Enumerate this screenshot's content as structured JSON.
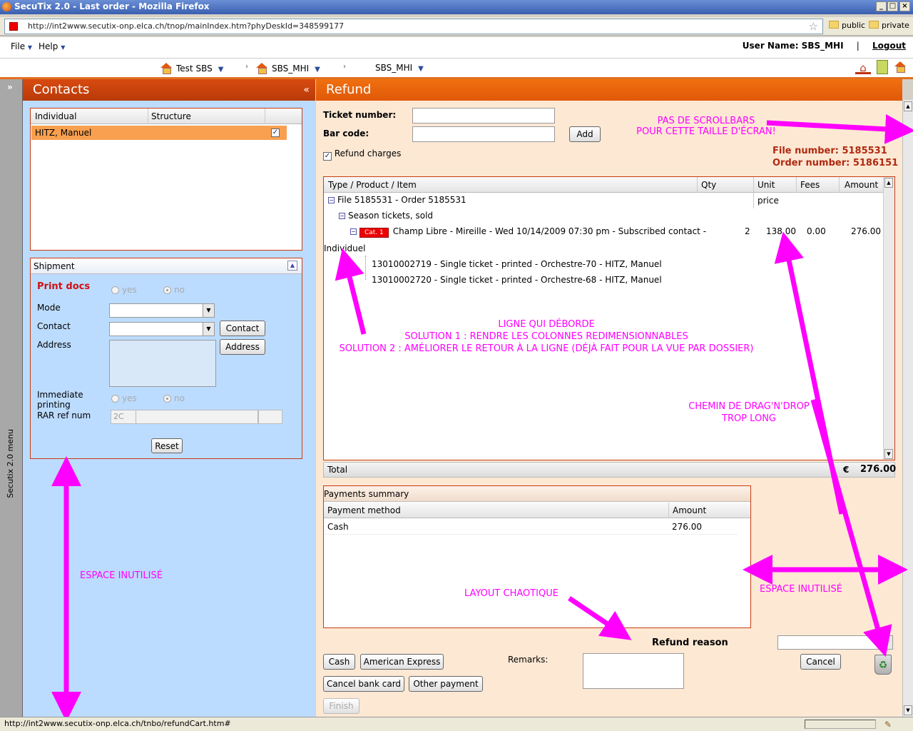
{
  "window": {
    "title": "SecuTix 2.0 - Last order - Mozilla Firefox"
  },
  "browser": {
    "url": "http://int2www.secutix-onp.elca.ch/tnop/mainIndex.htm?phyDeskId=348599177",
    "bookmarks": [
      "public",
      "private"
    ],
    "status_url": "http://int2www.secutix-onp.elca.ch/tnbo/refundCart.htm#"
  },
  "menubar": {
    "file": "File",
    "help": "Help",
    "user_name": "User Name: SBS_MHI",
    "separator": "|",
    "logout": "Logout"
  },
  "nav": {
    "items": [
      "Test SBS",
      "SBS_MHI",
      "SBS_MHI"
    ]
  },
  "sidebar": {
    "label": "Secutix 2.0 menu",
    "expand": "»"
  },
  "contacts": {
    "title": "Contacts",
    "collapse": "«",
    "columns": [
      "Individual",
      "Structure"
    ],
    "rows": [
      {
        "individual": "HITZ, Manuel",
        "checked": true
      }
    ]
  },
  "shipment": {
    "title": "Shipment",
    "print_docs": "Print docs",
    "yes": "yes",
    "no": "no",
    "mode": "Mode",
    "contact": "Contact",
    "contact_btn": "Contact",
    "address": "Address",
    "address_btn": "Address",
    "immediate_printing": "Immediate printing",
    "rar_ref_num": "RAR ref num",
    "rar_value": "2C",
    "reset": "Reset"
  },
  "refund": {
    "title": "Refund",
    "ticket_number_label": "Ticket number:",
    "bar_code_label": "Bar code:",
    "add_btn": "Add",
    "refund_charges": "Refund charges",
    "file_number": "File number: 5185531",
    "order_number": "Order number: 5186151",
    "grid": {
      "columns": [
        "Type / Product / Item",
        "Qty",
        "Unit price",
        "Fees",
        "Amount"
      ],
      "file_row": "File 5185531 - Order 5185531",
      "season_row": "Season tickets, sold",
      "cat": "Cat. 1",
      "item_row": "Champ Libre - Mireille - Wed 10/14/2009 07:30 pm - Subscribed contact -",
      "item_wrap": "Individuel",
      "item_qty": "2",
      "item_unit": "138.00",
      "item_fees": "0.00",
      "item_amount": "276.00",
      "tickets": [
        "13010002719 - Single ticket - printed - Orchestre-70 - HITZ, Manuel",
        "13010002720 - Single ticket - printed - Orchestre-68 - HITZ, Manuel"
      ],
      "total_label": "Total",
      "total_currency": "€",
      "total_amount": "276.00"
    },
    "payments": {
      "title": "Payments summary",
      "columns": [
        "Payment method",
        "Amount"
      ],
      "rows": [
        {
          "method": "Cash",
          "amount": "276.00"
        }
      ]
    },
    "refund_reason": "Refund reason",
    "remarks": "Remarks:",
    "buttons": {
      "cash": "Cash",
      "amex": "American Express",
      "cancel_bank_card": "Cancel bank card",
      "other_payment": "Other payment",
      "finish": "Finish",
      "cancel": "Cancel"
    }
  },
  "annotations": {
    "scrollbars": [
      "PAS DE SCROLLBARS",
      "POUR CETTE TAILLE D'ÉCRAN!"
    ],
    "overflow": [
      "LIGNE QUI DÉBORDE",
      "SOLUTION 1 : RENDRE LES COLONNES REDIMENSIONNABLES",
      "SOLUTION 2 : AMÉLIORER LE RETOUR À LA LIGNE (DÉJÀ FAIT POUR LA VUE PAR DOSSIER)"
    ],
    "dragdrop": [
      "CHEMIN DE DRAG'N'DROP",
      "TROP LONG"
    ],
    "unused_left": "ESPACE INUTILISÉ",
    "unused_right": "ESPACE INUTILISÉ",
    "layout": "LAYOUT CHAOTIQUE"
  },
  "colors": {
    "accent": "#d84a10",
    "annotation": "#ff00ff",
    "left_bg": "#bcdcff",
    "right_bg": "#fde8d4",
    "selected_row": "#f8a050"
  }
}
